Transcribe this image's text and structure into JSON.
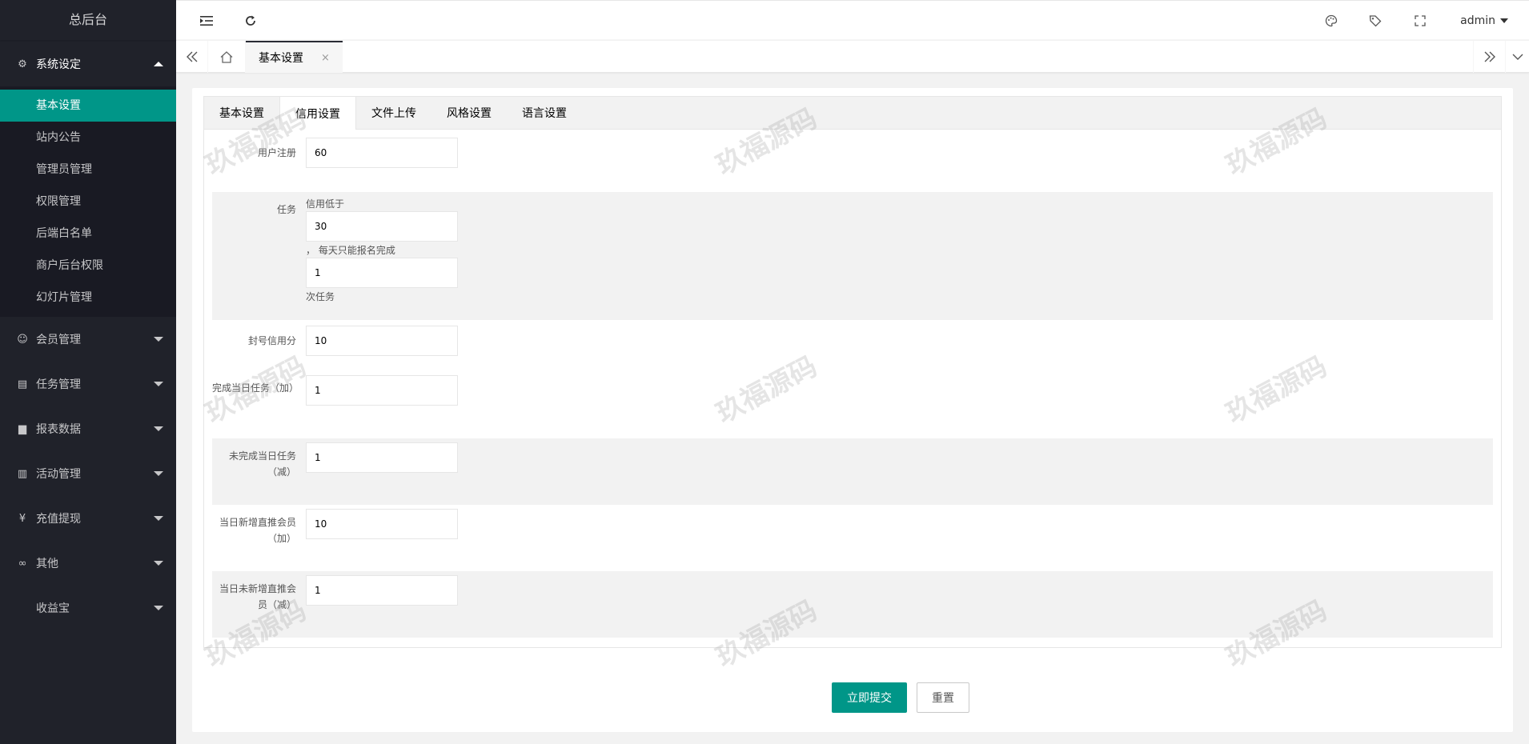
{
  "sidebar": {
    "logo": "总后台",
    "groups": [
      {
        "label": "系统设定",
        "icon": "gear-icon",
        "glyph": "⚙"
      },
      {
        "label": "会员管理",
        "icon": "user-icon",
        "glyph": "☺"
      },
      {
        "label": "任务管理",
        "icon": "document-icon",
        "glyph": "▤"
      },
      {
        "label": "报表数据",
        "icon": "chart-icon",
        "glyph": "▆"
      },
      {
        "label": "活动管理",
        "icon": "book-icon",
        "glyph": "▥"
      },
      {
        "label": "充值提现",
        "icon": "yen-icon",
        "glyph": "¥"
      },
      {
        "label": "其他",
        "icon": "link-icon",
        "glyph": "∞"
      },
      {
        "label": "收益宝",
        "icon": "",
        "glyph": ""
      }
    ],
    "submenu": [
      "基本设置",
      "站内公告",
      "管理员管理",
      "权限管理",
      "后端白名单",
      "商户后台权限",
      "幻灯片管理"
    ]
  },
  "header": {
    "admin": "admin"
  },
  "tabsbar": {
    "current_tab": "基本设置",
    "close": "×"
  },
  "form_tabs": [
    "基本设置",
    "信用设置",
    "文件上传",
    "风格设置",
    "语言设置"
  ],
  "form": {
    "register_label": "用户注册",
    "register_value": "60",
    "task_label": "任务",
    "task_hint1": "信用低于",
    "task_value1": "30",
    "task_hint2": "，  每天只能报名完成",
    "task_value2": "1",
    "task_hint3": "次任务",
    "ban_label": "封号信用分",
    "ban_value": "10",
    "complete_label": "完成当日任务（加）",
    "complete_value": "1",
    "incomplete_label": "未完成当日任务（减）",
    "incomplete_value": "1",
    "newdirect_label": "当日新增直推会员（加）",
    "newdirect_value": "10",
    "nonewdirect_label": "当日未新增直推会员（减）",
    "nonewdirect_value": "1"
  },
  "buttons": {
    "submit": "立即提交",
    "reset": "重置"
  },
  "watermark": "玖福源码"
}
